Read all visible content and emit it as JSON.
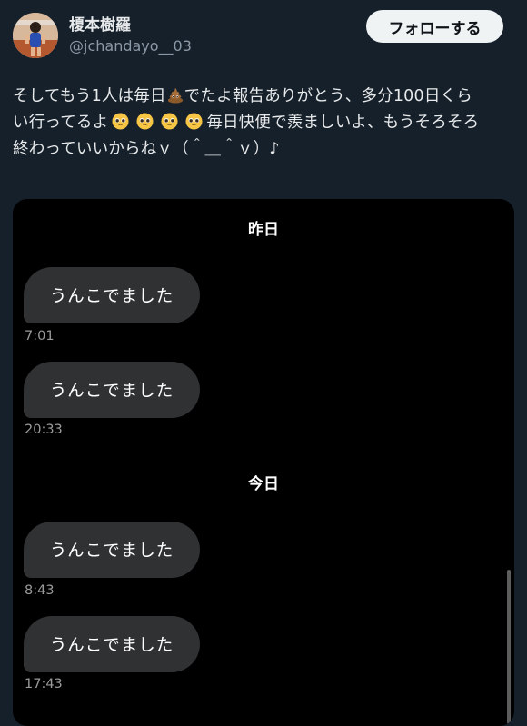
{
  "header": {
    "display_name": "榎本樹羅",
    "handle": "@jchandayo__03",
    "follow_label": "フォローする"
  },
  "tweet": {
    "line1_a": "そしてもう1人は毎日",
    "line1_b": "でたよ報告ありがとう、多分100日くら",
    "line2_a": "い行ってるよ",
    "line2_b": "毎日快便で羨ましいよ、もうそろそろ",
    "line3": "終わっていいからねｖ（＾＿＾ｖ）♪",
    "emoji_poop": "poop-emoji",
    "emoji_face": "pleading-face-emoji",
    "emoji_face_count": 4
  },
  "chat": {
    "groups": [
      {
        "date": "昨日",
        "messages": [
          {
            "text": "うんこでました",
            "time": "7:01"
          },
          {
            "text": "うんこでました",
            "time": "20:33"
          }
        ]
      },
      {
        "date": "今日",
        "messages": [
          {
            "text": "うんこでました",
            "time": "8:43"
          },
          {
            "text": "うんこでました",
            "time": "17:43"
          }
        ]
      }
    ]
  },
  "colors": {
    "background": "#15202b",
    "media_background": "#000000",
    "bubble": "#2f3133",
    "follow_button": "#eff3f4"
  }
}
